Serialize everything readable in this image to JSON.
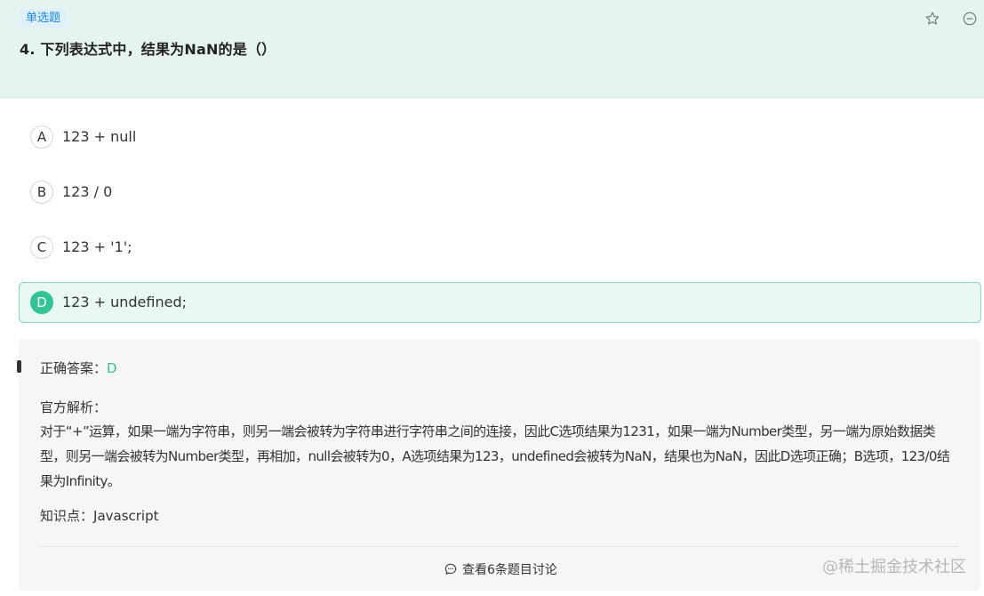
{
  "question": {
    "type": "单选题",
    "title": "4. 下列表达式中，结果为NaN的是（）",
    "icons": [
      "star-icon",
      "minus-circle-icon"
    ]
  },
  "options": [
    {
      "letter": "A",
      "text": "123 + null"
    },
    {
      "letter": "B",
      "text": "123 / 0"
    },
    {
      "letter": "C",
      "text": "123 + '1';"
    },
    {
      "letter": "D",
      "text": "123 + undefined;"
    }
  ],
  "analysis": {
    "answer_label": "正确答案：",
    "answer_value": "D",
    "explanation_label": "官方解析：",
    "explanation_text": "对于“+”运算，如果一端为字符串，则另一端会被转为字符串进行字符串之间的连接，因此C选项结果为1231，如果一端为Number类型，另一端为原始数据类型，则另一端会被转为Number类型，再相加，null会被转为0，A选项结果为123，undefined会被转为NaN，结果也为NaN，因此D选项正确；B选项，123/0结果为Infinity。",
    "knowledge_label": "知识点：",
    "knowledge_value": "Javascript",
    "discuss_label": "查看6条题目讨论"
  },
  "watermark": "@稀土掘金技术社区",
  "colors": {
    "accent": "#33c496",
    "header_bg": "#e6f4f1",
    "tag_text": "#1a8be0"
  }
}
